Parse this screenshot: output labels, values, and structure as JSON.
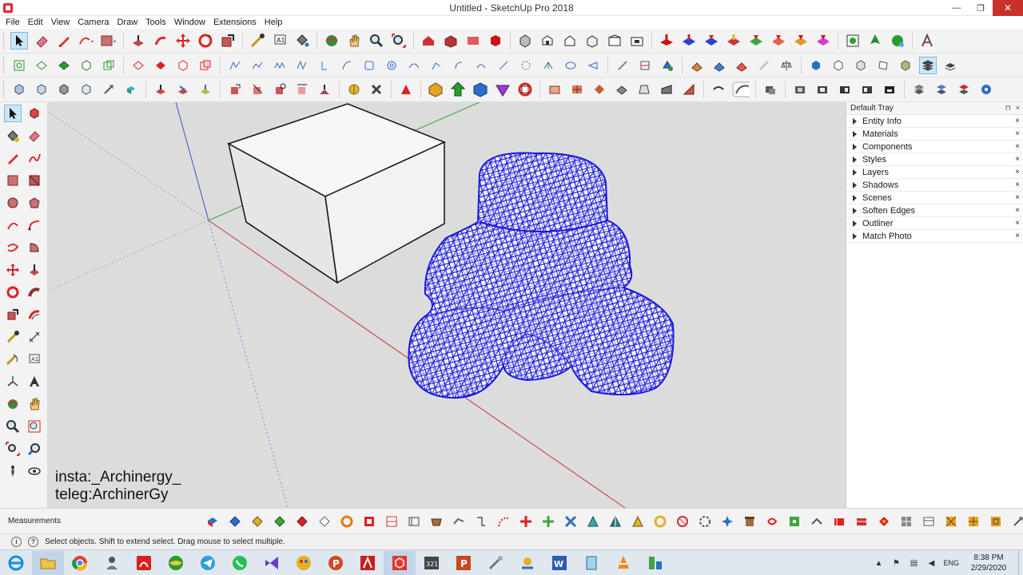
{
  "window": {
    "title": "Untitled - SketchUp Pro 2018",
    "minimize": "—",
    "restore": "❐",
    "close": "✕"
  },
  "menu": [
    "File",
    "Edit",
    "View",
    "Camera",
    "Draw",
    "Tools",
    "Window",
    "Extensions",
    "Help"
  ],
  "watermark": {
    "line1": "insta:_Archinergy_",
    "line2": "teleg:ArchinerGy"
  },
  "tray": {
    "title": "Default Tray",
    "pin": "⊓",
    "close": "×",
    "panels": [
      "Entity Info",
      "Materials",
      "Components",
      "Styles",
      "Layers",
      "Shadows",
      "Scenes",
      "Soften Edges",
      "Outliner",
      "Match Photo"
    ]
  },
  "measurements": {
    "label": "Measurements"
  },
  "status": {
    "icon": "?",
    "text": "Select objects. Shift to extend select. Drag mouse to select multiple."
  },
  "taskbar": {
    "language": "ENG",
    "time": "8:38 PM",
    "date": "2/29/2020"
  },
  "colors": {
    "accent_red": "#d9302c",
    "mesh_blue": "#1a1adb",
    "axis_red": "#cc3333",
    "axis_green": "#3aa53a",
    "axis_blue": "#3355cc"
  }
}
